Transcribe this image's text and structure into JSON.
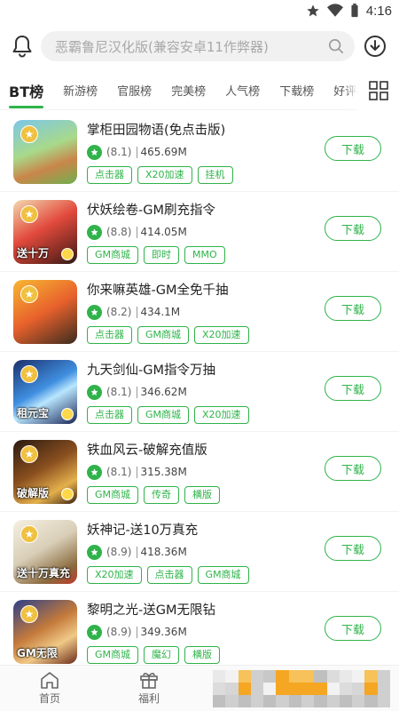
{
  "status_bar": {
    "time": "4:16"
  },
  "search": {
    "placeholder": "恶霸鲁尼汉化版(兼容安卓11作弊器)"
  },
  "tabs": [
    {
      "label": "BT榜",
      "active": true
    },
    {
      "label": "新游榜"
    },
    {
      "label": "官服榜"
    },
    {
      "label": "完美榜"
    },
    {
      "label": "人气榜"
    },
    {
      "label": "下载榜"
    },
    {
      "label": "好评榜"
    }
  ],
  "games": [
    {
      "name": "掌柜田园物语(免点击版)",
      "rating": "(8.1)",
      "size": "465.69M",
      "tags": [
        "点击器",
        "X20加速",
        "挂机"
      ],
      "download": "下载"
    },
    {
      "name": "伏妖绘卷-GM刷充指令",
      "rating": "(8.8)",
      "size": "414.05M",
      "tags": [
        "GM商城",
        "即时",
        "MMO"
      ],
      "download": "下载"
    },
    {
      "name": "你来嘛英雄-GM全免千抽",
      "rating": "(8.2)",
      "size": "434.1M",
      "tags": [
        "点击器",
        "GM商城",
        "X20加速"
      ],
      "download": "下载"
    },
    {
      "name": "九天剑仙-GM指令万抽",
      "rating": "(8.1)",
      "size": "346.62M",
      "tags": [
        "点击器",
        "GM商城",
        "X20加速"
      ],
      "download": "下载"
    },
    {
      "name": "铁血风云-破解充值版",
      "rating": "(8.1)",
      "size": "315.38M",
      "tags": [
        "GM商城",
        "传奇",
        "横版"
      ],
      "download": "下载"
    },
    {
      "name": "妖神记-送10万真充",
      "rating": "(8.9)",
      "size": "418.36M",
      "tags": [
        "X20加速",
        "点击器",
        "GM商城"
      ],
      "download": "下载"
    },
    {
      "name": "黎明之光-送GM无限钻",
      "rating": "(8.9)",
      "size": "349.36M",
      "tags": [
        "GM商城",
        "魔幻",
        "横版"
      ],
      "download": "下载"
    }
  ],
  "thumb_text": [
    "",
    "送十万",
    "",
    "租元宝",
    "破解版",
    "送十万真充",
    "GM无限"
  ],
  "bottom_nav": [
    {
      "label": "首页",
      "icon": "home-icon"
    },
    {
      "label": "福利",
      "icon": "gift-icon"
    }
  ],
  "colors": {
    "accent": "#2fb34a",
    "star": "#f0c040"
  }
}
